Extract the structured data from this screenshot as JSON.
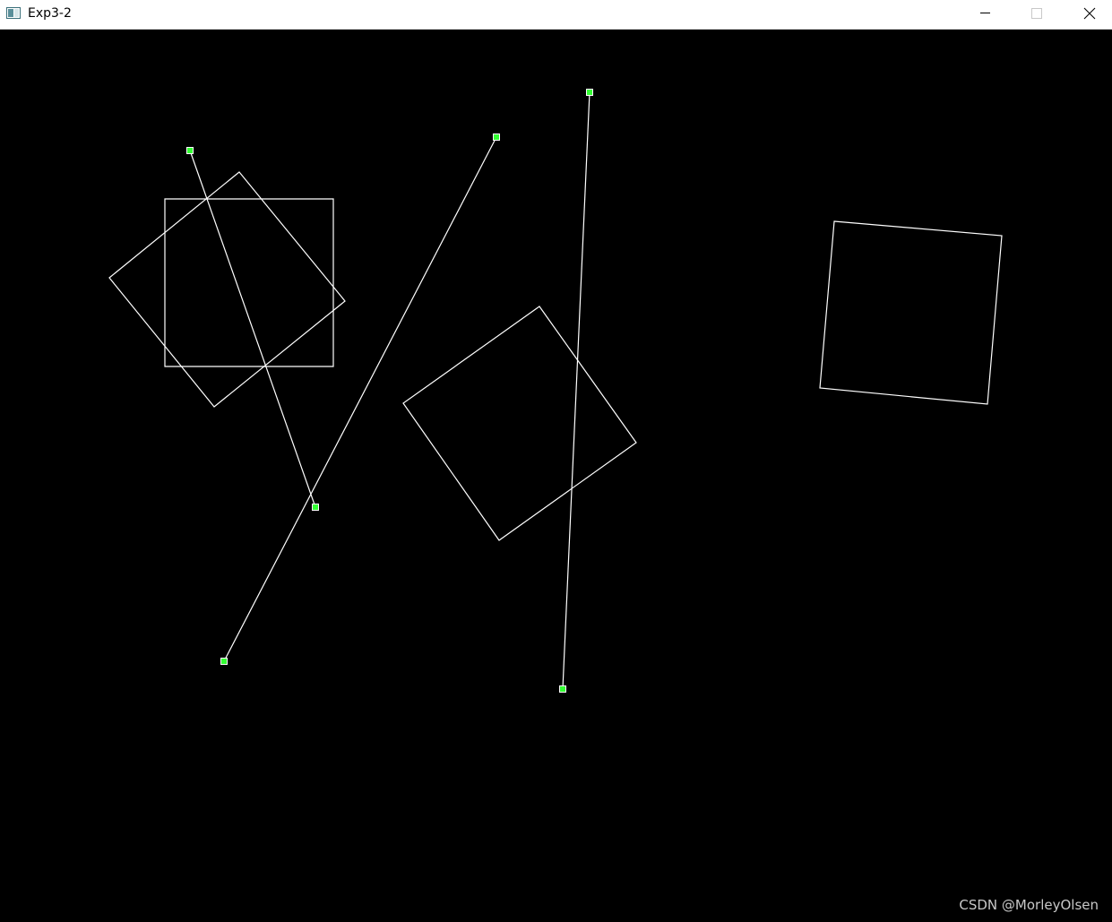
{
  "window": {
    "title": "Exp3-2",
    "app_icon": "application-window-icon",
    "controls": {
      "minimize_icon": "minimize-icon",
      "maximize_icon": "maximize-icon",
      "close_icon": "close-icon"
    }
  },
  "colors": {
    "canvas_background": "#000000",
    "shape_stroke": "#ffffff",
    "control_point_fill": "#33ff33",
    "control_point_border": "#ffffff"
  },
  "watermark": "CSDN @MorleyOlsen"
}
